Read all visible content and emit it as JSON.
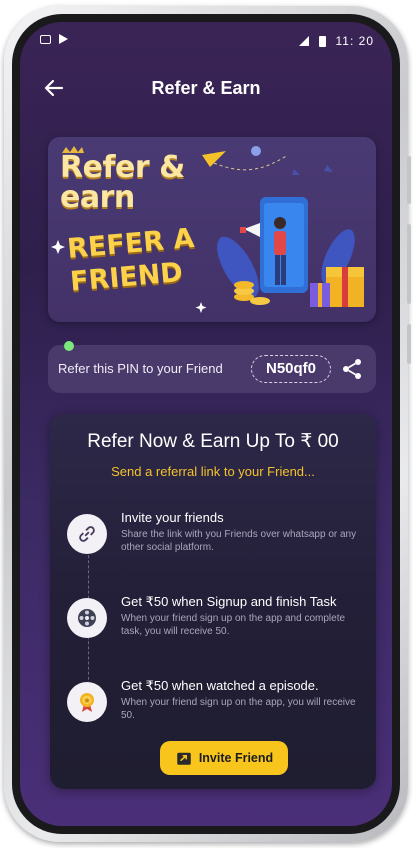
{
  "status_bar": {
    "time": "11: 20"
  },
  "header": {
    "title": "Refer & Earn"
  },
  "banner": {
    "line1": "Refer &",
    "line2": "earn",
    "line3": "REFER A",
    "line4": "FRIEND"
  },
  "pin": {
    "label": "Refer this PIN to your Friend",
    "code": "N50qf0"
  },
  "card": {
    "title": "Refer Now & Earn Up To ₹ 00",
    "subtitle": "Send a referral link to your Friend...",
    "steps": [
      {
        "icon": "link-icon",
        "title": "Invite your friends",
        "desc": "Share the link with you Friends over whatsapp or any other social platform."
      },
      {
        "icon": "film-reel-icon",
        "title": "Get ₹50 when Signup and finish Task",
        "desc": "When your friend sign up on the app and complete task, you will receive 50."
      },
      {
        "icon": "award-medal-icon",
        "title": "Get ₹50 when watched a episode.",
        "desc": "When your friend sign up on the app, you will receive 50."
      }
    ],
    "invite_button": "Invite Friend"
  },
  "colors": {
    "accent": "#f8c51c",
    "subtitle": "#f5c22b",
    "background": "#2e1f4c"
  }
}
